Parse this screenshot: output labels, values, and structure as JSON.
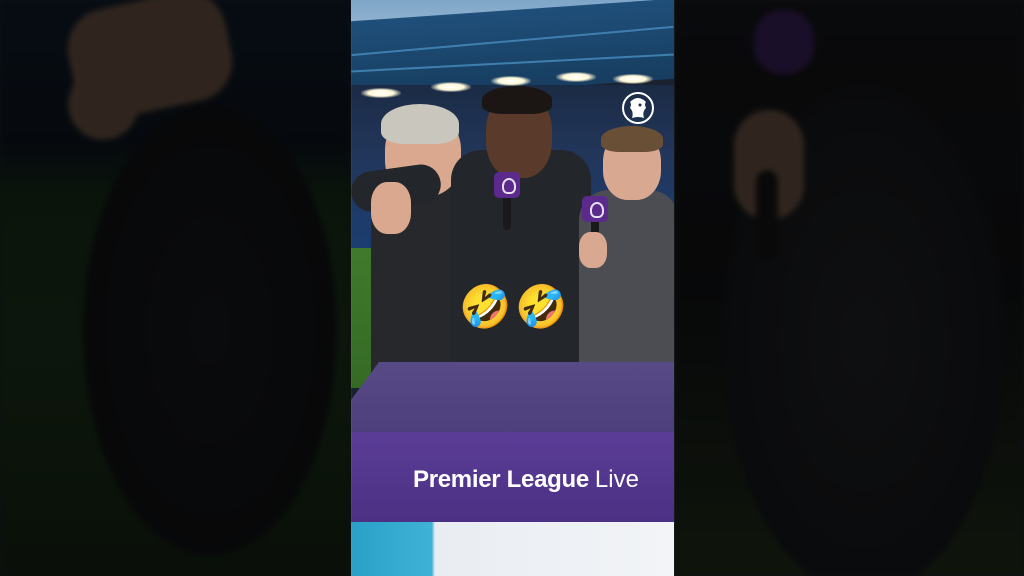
{
  "broadcast": {
    "desk_label_main": "Premier League",
    "desk_label_accent": "Live"
  },
  "overlay": {
    "emojis": [
      "🤣",
      "🤣"
    ]
  },
  "icons": {
    "logo": "premier-league-lion-icon",
    "mic_cube": "mic-cube-icon"
  },
  "colors": {
    "brand_purple": "#4a2f82",
    "desk_top": "#574a86",
    "cyan_accent": "#3fb3d6",
    "pitch_green": "#3f7a2c",
    "stand_blue": "#1b3e73"
  }
}
